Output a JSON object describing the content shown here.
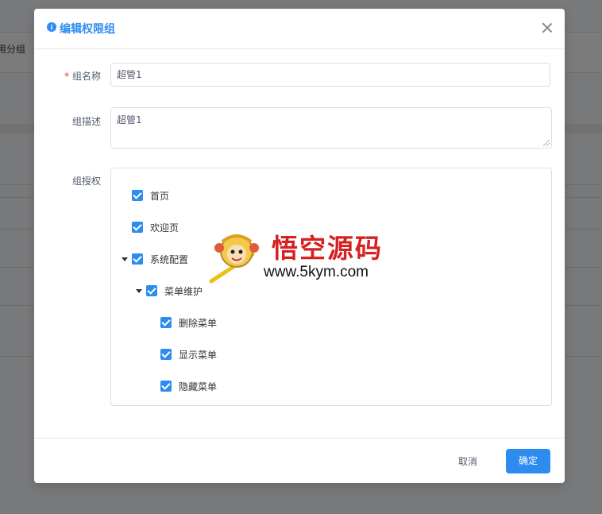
{
  "background": {
    "header_label": "用分组"
  },
  "modal": {
    "title": "编辑权限组",
    "title_icon": "info-circle-icon",
    "close_icon": "close-icon",
    "fields": {
      "name_label": "组名称",
      "name_required_mark": "*",
      "name_value": "超管1",
      "desc_label": "组描述",
      "desc_value": "超管1",
      "auth_label": "组授权"
    },
    "tree": [
      {
        "label": "首页",
        "checked": true,
        "expanded": null,
        "level": 0
      },
      {
        "label": "欢迎页",
        "checked": true,
        "expanded": null,
        "level": 0
      },
      {
        "label": "系统配置",
        "checked": true,
        "expanded": true,
        "level": 0
      },
      {
        "label": "菜单维护",
        "checked": true,
        "expanded": true,
        "level": 1
      },
      {
        "label": "删除菜单",
        "checked": true,
        "expanded": null,
        "level": 2
      },
      {
        "label": "显示菜单",
        "checked": true,
        "expanded": null,
        "level": 2
      },
      {
        "label": "隐藏菜单",
        "checked": true,
        "expanded": null,
        "level": 2
      }
    ],
    "footer": {
      "cancel_label": "取消",
      "ok_label": "确定"
    }
  },
  "watermark": {
    "text": "悟空源码",
    "url": "www.5kym.com"
  },
  "colors": {
    "primary": "#2d8cf0",
    "required": "#ed4014",
    "watermark_red": "#d72020"
  }
}
